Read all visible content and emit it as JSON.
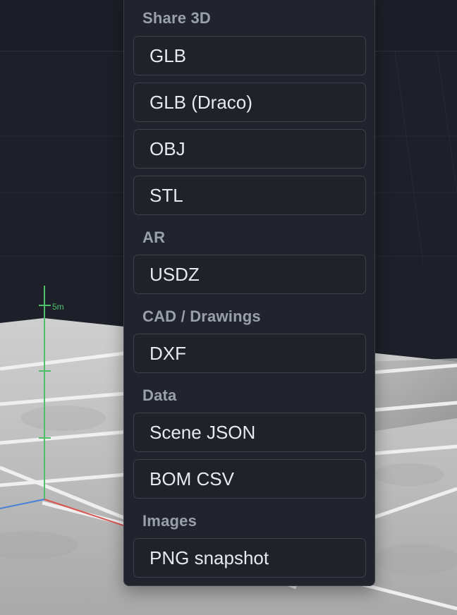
{
  "menu": {
    "sections": [
      {
        "label": "Share 3D",
        "items": [
          "GLB",
          "GLB (Draco)",
          "OBJ",
          "STL"
        ]
      },
      {
        "label": "AR",
        "items": [
          "USDZ"
        ]
      },
      {
        "label": "CAD / Drawings",
        "items": [
          "DXF"
        ]
      },
      {
        "label": "Data",
        "items": [
          "Scene JSON",
          "BOM CSV"
        ]
      },
      {
        "label": "Images",
        "items": [
          "PNG snapshot"
        ]
      }
    ]
  },
  "viewport": {
    "dimension_label": "5m"
  },
  "colors": {
    "menu_background": "#21242c",
    "item_background": "#1f2229",
    "section_label": "#9aa0ab",
    "item_text": "#e7e9ee",
    "axis_green": "#4fbf6a",
    "axis_red": "#d9534f",
    "axis_blue": "#4a7fd6"
  }
}
